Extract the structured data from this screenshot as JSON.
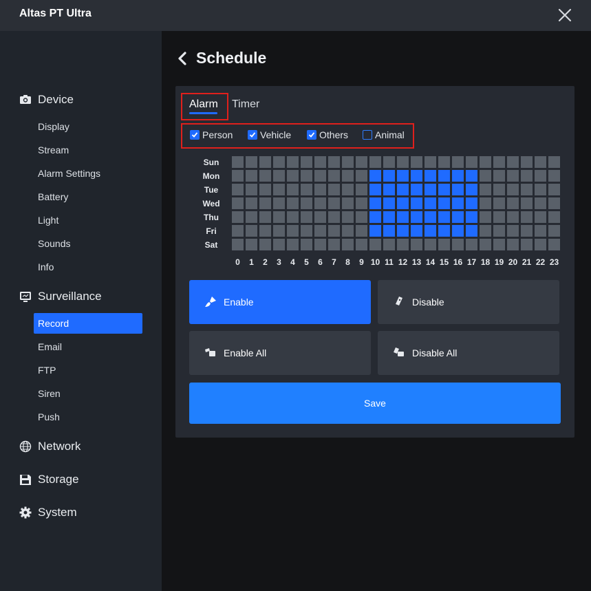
{
  "app": {
    "title": "Altas PT Ultra"
  },
  "sidebar": {
    "device": {
      "label": "Device",
      "icon": "camera-icon",
      "items": [
        "Display",
        "Stream",
        "Alarm Settings",
        "Battery",
        "Light",
        "Sounds",
        "Info"
      ]
    },
    "surveillance": {
      "label": "Surveillance",
      "icon": "monitor-icon",
      "items": [
        "Record",
        "Email",
        "FTP",
        "Siren",
        "Push"
      ],
      "active": "Record"
    },
    "network": {
      "label": "Network",
      "icon": "globe-icon"
    },
    "storage": {
      "label": "Storage",
      "icon": "floppy-disk-icon"
    },
    "system": {
      "label": "System",
      "icon": "gear-icon"
    }
  },
  "page": {
    "title": "Schedule"
  },
  "tabs": {
    "alarm": "Alarm",
    "timer": "Timer",
    "active": "Alarm"
  },
  "filters": [
    {
      "label": "Person",
      "checked": true
    },
    {
      "label": "Vehicle",
      "checked": true
    },
    {
      "label": "Others",
      "checked": true
    },
    {
      "label": "Animal",
      "checked": false
    }
  ],
  "schedule": {
    "days": [
      "Sun",
      "Mon",
      "Tue",
      "Wed",
      "Thu",
      "Fri",
      "Sat"
    ],
    "hours": [
      "0",
      "1",
      "2",
      "3",
      "4",
      "5",
      "6",
      "7",
      "8",
      "9",
      "10",
      "11",
      "12",
      "13",
      "14",
      "15",
      "16",
      "17",
      "18",
      "19",
      "20",
      "21",
      "22",
      "23"
    ],
    "enabled": {
      "Sun": [],
      "Mon": [
        10,
        11,
        12,
        13,
        14,
        15,
        16,
        17
      ],
      "Tue": [
        10,
        11,
        12,
        13,
        14,
        15,
        16,
        17
      ],
      "Wed": [
        10,
        11,
        12,
        13,
        14,
        15,
        16,
        17
      ],
      "Thu": [
        10,
        11,
        12,
        13,
        14,
        15,
        16,
        17
      ],
      "Fri": [
        10,
        11,
        12,
        13,
        14,
        15,
        16,
        17
      ],
      "Sat": []
    }
  },
  "buttons": {
    "enable": {
      "label": "Enable",
      "icon": "brush-icon"
    },
    "disable": {
      "label": "Disable",
      "icon": "eraser-icon"
    },
    "enable_all": {
      "label": "Enable All",
      "icon": "paint-bucket-icon"
    },
    "disable_all": {
      "label": "Disable All",
      "icon": "clear-all-icon"
    },
    "save": {
      "label": "Save"
    }
  },
  "colors": {
    "accent": "#1f6bff",
    "cell_off": "#596069",
    "highlight_box": "#e0201c"
  }
}
